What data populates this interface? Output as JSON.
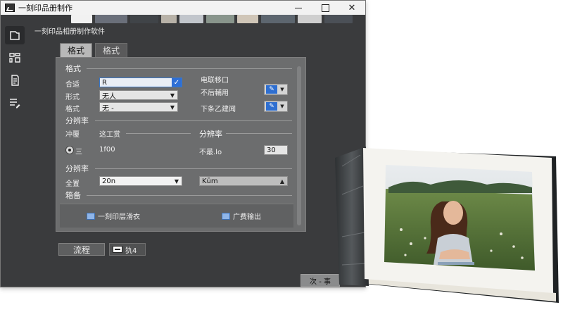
{
  "window": {
    "title": "一刻印品册制作",
    "subtitle": "一刻印品相册制作软件"
  },
  "thumbnails": [
    "#f1f1f1",
    "#6a6f7a",
    "#404448",
    "#b8b2a8",
    "#c2c6cc",
    "#89958c",
    "#d0c6b8",
    "#5d666f",
    "#cfcfcf",
    "#4b5057"
  ],
  "sidebar": [
    {
      "icon": "page-icon",
      "active": true
    },
    {
      "icon": "layout-icon",
      "active": false
    },
    {
      "icon": "document-icon",
      "active": false
    },
    {
      "icon": "list-edit-icon",
      "active": false
    }
  ],
  "tabs": [
    {
      "label": "格式",
      "active": true
    },
    {
      "label": "格式",
      "active": false
    }
  ],
  "format_section": {
    "title": "格式",
    "rows": [
      {
        "label": "合适",
        "value": "R"
      },
      {
        "label": "形式",
        "value": "无人"
      },
      {
        "label": "格式",
        "value": "无 -"
      }
    ],
    "right_title": "电联移口",
    "right_rows": [
      {
        "label": "不后輔用"
      },
      {
        "label": "下条乙建闻"
      }
    ]
  },
  "resolution_section": {
    "title": "分辨率",
    "left_label": "冲覆",
    "left_value": "这工赏",
    "right_title": "分辨率",
    "radio_label": "三",
    "left_number": "1f00",
    "right_label": "不最.lo",
    "right_value": "30"
  },
  "resolution_section_2": {
    "title": "分辨率",
    "label": "全置",
    "value": "20n",
    "right_value": "Kūm"
  },
  "backup_section": {
    "title": "箱备",
    "action_left": "一刻印层滑衣",
    "action_right": "广费输出"
  },
  "footer": {
    "flow_button": "流程",
    "export_button": "犰4",
    "next_button": "次 - 事"
  },
  "colors": {
    "window_bg": "#3a3b3d",
    "panel_bg": "#6c6d6e",
    "accent": "#2e6fd6"
  }
}
